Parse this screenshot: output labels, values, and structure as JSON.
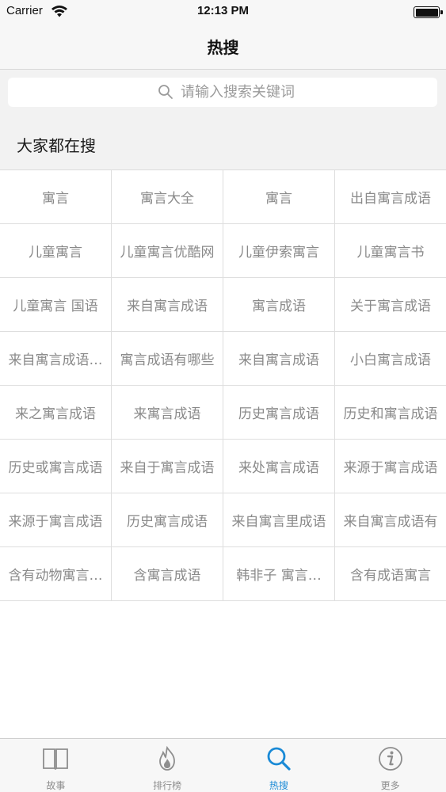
{
  "status_bar": {
    "carrier": "Carrier",
    "time": "12:13 PM"
  },
  "nav": {
    "title": "热搜"
  },
  "search": {
    "placeholder": "请输入搜索关键词",
    "value": ""
  },
  "section": {
    "title": "大家都在搜"
  },
  "hot_terms": [
    "寓言",
    "寓言大全",
    "寓言",
    "出自寓言成语",
    "儿童寓言",
    "儿童寓言优酷网",
    "儿童伊索寓言",
    "儿童寓言书",
    "儿童寓言 国语",
    "来自寓言成语",
    "寓言成语",
    "关于寓言成语",
    "来自寓言成语…",
    "寓言成语有哪些",
    "来自寓言成语",
    "小白寓言成语",
    "来之寓言成语",
    "来寓言成语",
    "历史寓言成语",
    "历史和寓言成语",
    "历史或寓言成语",
    "来自于寓言成语",
    "来处寓言成语",
    "来源于寓言成语",
    "来源于寓言成语",
    "历史寓言成语",
    "来自寓言里成语",
    "来自寓言成语有",
    "含有动物寓言…",
    "含寓言成语",
    "韩非子 寓言…",
    "含有成语寓言"
  ],
  "tabs": [
    {
      "label": "故事",
      "icon": "book-icon",
      "active": false
    },
    {
      "label": "排行榜",
      "icon": "flame-icon",
      "active": false
    },
    {
      "label": "热搜",
      "icon": "search-icon",
      "active": true
    },
    {
      "label": "更多",
      "icon": "info-icon",
      "active": false
    }
  ],
  "colors": {
    "accent": "#1a8ad6",
    "inactive": "#8e8e8e",
    "cell_text": "#8a8a8a",
    "section_bg": "#f2f2f2"
  }
}
